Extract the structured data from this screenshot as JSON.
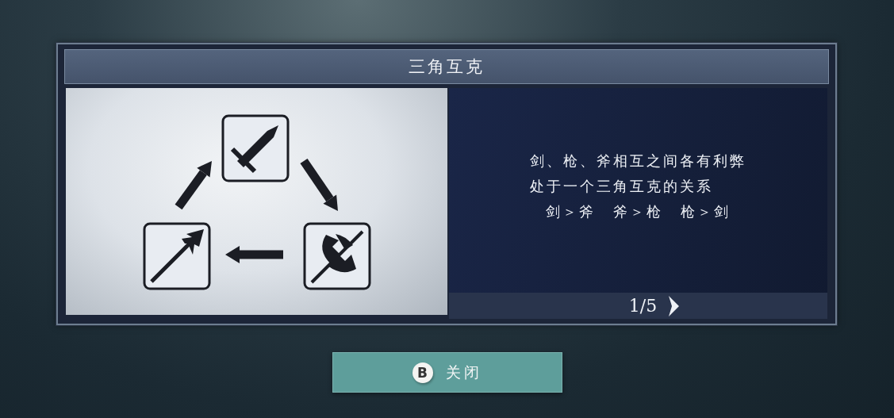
{
  "dialog": {
    "title": "三角互克",
    "description_lines": [
      "剑、枪、斧相互之间各有利弊",
      "处于一个三角互克的关系"
    ],
    "relations": [
      "剑＞斧",
      "斧＞枪",
      "枪＞剑"
    ],
    "pager": {
      "page": "1/5"
    }
  },
  "close_button": {
    "key": "B",
    "label": "关闭"
  }
}
